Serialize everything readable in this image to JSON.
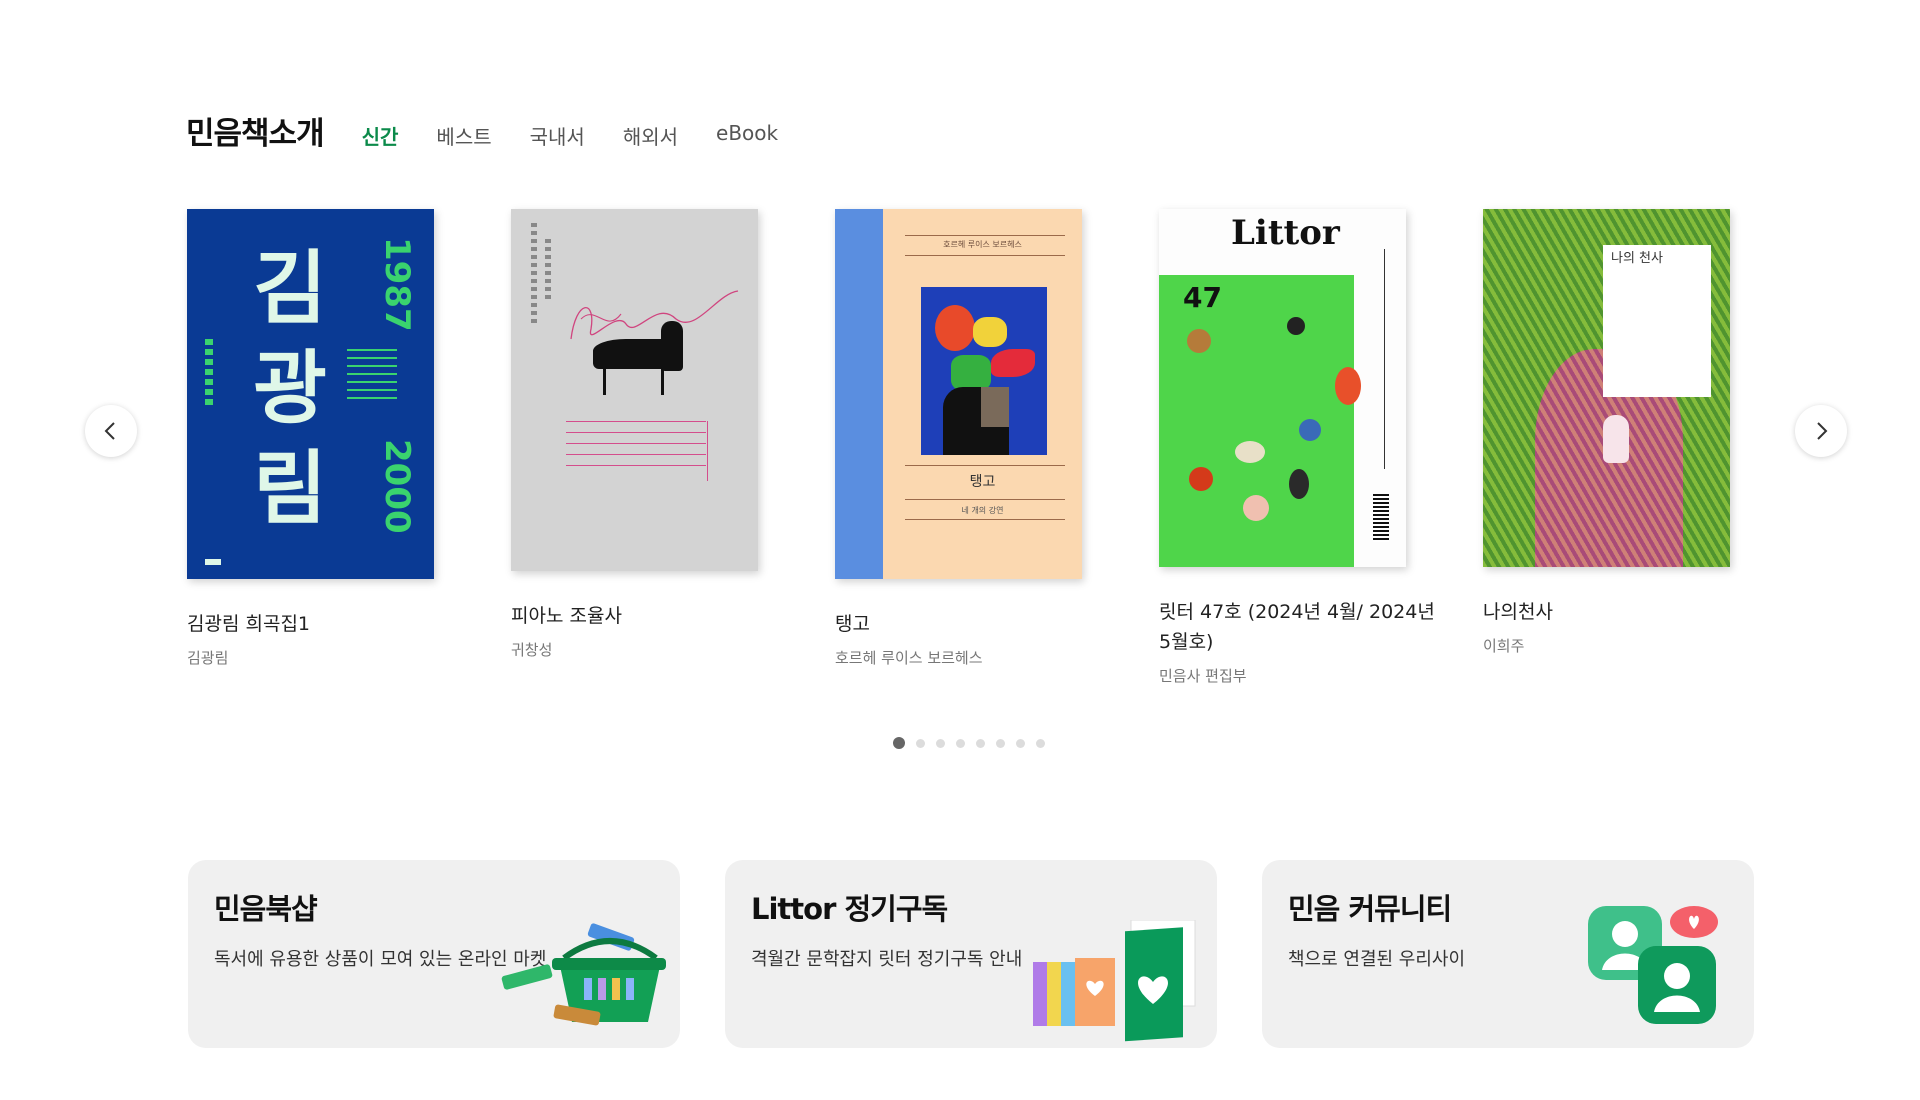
{
  "section": {
    "title": "민음책소개",
    "tabs": [
      {
        "label": "신간",
        "active": true
      },
      {
        "label": "베스트",
        "active": false
      },
      {
        "label": "국내서",
        "active": false
      },
      {
        "label": "해외서",
        "active": false
      },
      {
        "label": "eBook",
        "active": false
      }
    ]
  },
  "carousel": {
    "books": [
      {
        "title": "김광림 희곡집1",
        "author": "김광림",
        "cover_big_text": "김광림",
        "cover_years": [
          "1987",
          "2000"
        ]
      },
      {
        "title": "피아노 조율사",
        "author": "귀창성"
      },
      {
        "title": "탱고",
        "author": "호르헤 루이스 보르헤스",
        "cover_title": "탱고",
        "cover_subtitle": "네 개의 강연",
        "cover_top": "호르헤 루이스 보르헤스"
      },
      {
        "title": "릿터 47호 (2024년 4월/ 2024년 5월호)",
        "author": "민음사 편집부",
        "cover_logo": "Littor",
        "cover_issue": "47"
      },
      {
        "title": "나의천사",
        "author": "이희주",
        "cover_title": "나의 천사"
      }
    ],
    "dots": 8,
    "active_dot": 0
  },
  "cards": [
    {
      "title": "민음북샵",
      "desc": "독서에 유용한 상품이 모여 있는 온라인 마켓"
    },
    {
      "title": "Littor 정기구독",
      "desc": "격월간 문학잡지 릿터 정기구독 안내"
    },
    {
      "title": "민음 커뮤니티",
      "desc": "책으로 연결된 우리사이"
    }
  ],
  "colors": {
    "accent": "#0b8a4a",
    "card_bg": "#f0f0f0"
  }
}
